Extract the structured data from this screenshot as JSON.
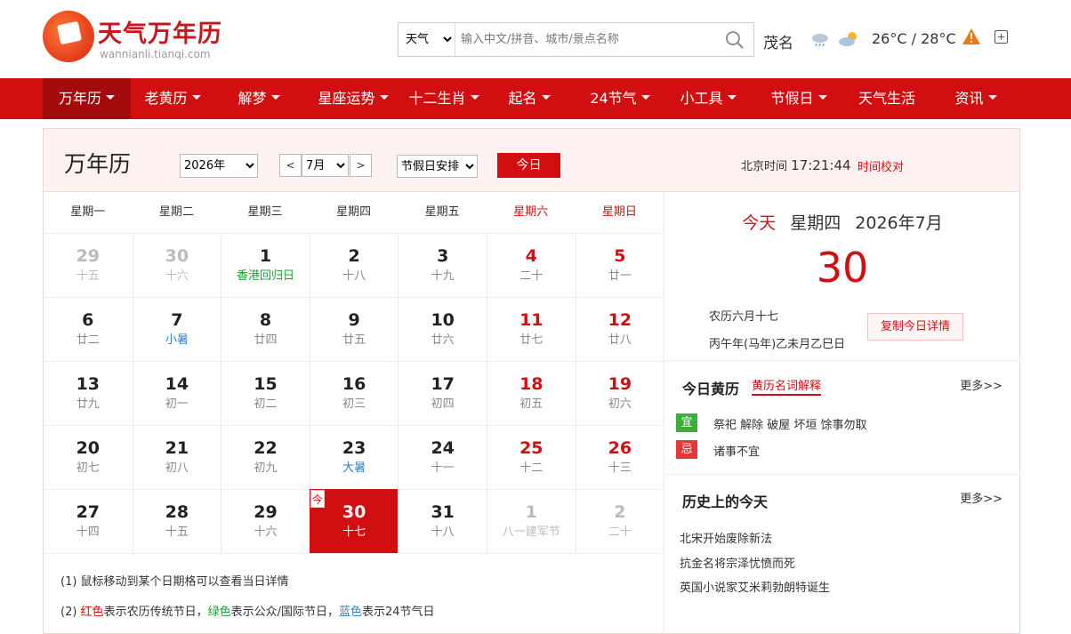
{
  "site": {
    "logo_title": "天气万年历",
    "logo_sub": "wannianli.tianqi.com"
  },
  "search": {
    "type": "天气",
    "placeholder": "输入中文/拼音、城市/景点名称"
  },
  "weather": {
    "city": "茂名",
    "temp": "26°C / 28°C"
  },
  "nav": [
    {
      "label": "万年历",
      "caret": true
    },
    {
      "label": "老黄历",
      "caret": true
    },
    {
      "label": "解梦",
      "caret": true
    },
    {
      "label": "星座运势",
      "caret": true
    },
    {
      "label": "十二生肖",
      "caret": true
    },
    {
      "label": "起名",
      "caret": true
    },
    {
      "label": "24节气",
      "caret": true
    },
    {
      "label": "小工具",
      "caret": true
    },
    {
      "label": "节假日",
      "caret": true
    },
    {
      "label": "天气生活",
      "caret": false
    },
    {
      "label": "资讯",
      "caret": true
    }
  ],
  "toolbar": {
    "title": "万年历",
    "year": "2026年",
    "prev": "<",
    "month": "7月",
    "next": ">",
    "holiday": "节假日安排",
    "today_btn": "今日",
    "time_label": "北京时间",
    "time": "17:21:44",
    "time_link": "时间校对"
  },
  "weekdays": [
    "星期一",
    "星期二",
    "星期三",
    "星期四",
    "星期五",
    "星期六",
    "星期日"
  ],
  "days": [
    {
      "d": "29",
      "l": "十五",
      "other": true
    },
    {
      "d": "30",
      "l": "十六",
      "other": true
    },
    {
      "d": "1",
      "l": "香港回归日",
      "lc": "green"
    },
    {
      "d": "2",
      "l": "十八"
    },
    {
      "d": "3",
      "l": "十九"
    },
    {
      "d": "4",
      "l": "二十",
      "weekend": true
    },
    {
      "d": "5",
      "l": "廿一",
      "weekend": true
    },
    {
      "d": "6",
      "l": "廿二"
    },
    {
      "d": "7",
      "l": "小暑",
      "lc": "blue"
    },
    {
      "d": "8",
      "l": "廿四"
    },
    {
      "d": "9",
      "l": "廿五"
    },
    {
      "d": "10",
      "l": "廿六"
    },
    {
      "d": "11",
      "l": "廿七",
      "weekend": true
    },
    {
      "d": "12",
      "l": "廿八",
      "weekend": true
    },
    {
      "d": "13",
      "l": "廿九"
    },
    {
      "d": "14",
      "l": "初一"
    },
    {
      "d": "15",
      "l": "初二"
    },
    {
      "d": "16",
      "l": "初三"
    },
    {
      "d": "17",
      "l": "初四"
    },
    {
      "d": "18",
      "l": "初五",
      "weekend": true
    },
    {
      "d": "19",
      "l": "初六",
      "weekend": true
    },
    {
      "d": "20",
      "l": "初七"
    },
    {
      "d": "21",
      "l": "初八"
    },
    {
      "d": "22",
      "l": "初九"
    },
    {
      "d": "23",
      "l": "大暑",
      "lc": "blue"
    },
    {
      "d": "24",
      "l": "十一"
    },
    {
      "d": "25",
      "l": "十二",
      "weekend": true
    },
    {
      "d": "26",
      "l": "十三",
      "weekend": true
    },
    {
      "d": "27",
      "l": "十四"
    },
    {
      "d": "28",
      "l": "十五"
    },
    {
      "d": "29",
      "l": "十六"
    },
    {
      "d": "30",
      "l": "十七",
      "today": true
    },
    {
      "d": "31",
      "l": "十八"
    },
    {
      "d": "1",
      "l": "八一建军节",
      "other": true
    },
    {
      "d": "2",
      "l": "二十",
      "other": true
    }
  ],
  "today_tag": "今",
  "notes": {
    "n1": "(1) 鼠标移动到某个日期格可以查看当日详情",
    "n2_pre": "(2) ",
    "n2_red": "红色",
    "n2_a": "表示农历传统节日，",
    "n2_green": "绿色",
    "n2_b": "表示公众/国际节日，",
    "n2_blue": "蓝色",
    "n2_c": "表示24节气日"
  },
  "side": {
    "today_word": "今天",
    "weekday": "星期四",
    "ym": "2026年7月",
    "big_day": "30",
    "lunar": "农历六月十七",
    "ganzhi": "丙午年(马年)乙未月乙巳日",
    "copy_btn": "复制今日详情",
    "almanac_title": "今日黄历",
    "almanac_link": "黄历名词解释",
    "more": "更多>>",
    "yi_tag": "宜",
    "yi_text": "祭祀 解除 破屋 坏垣 馀事勿取",
    "ji_tag": "忌",
    "ji_text": "诸事不宜",
    "history_title": "历史上的今天",
    "history": [
      "北宋开始废除新法",
      "抗金名将宗泽忧愤而死",
      "英国小说家艾米莉勃朗特诞生"
    ]
  },
  "colors": {
    "brand_red": "#d10f11",
    "green": "#1f9d33",
    "blue": "#2b7fc5"
  }
}
